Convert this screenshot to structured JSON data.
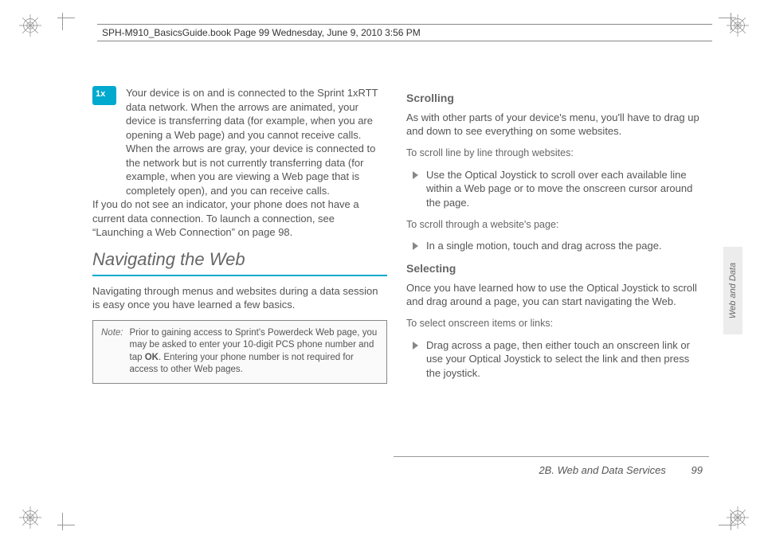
{
  "page_header": "SPH-M910_BasicsGuide.book  Page 99  Wednesday, June 9, 2010  3:56 PM",
  "left": {
    "icon_desc": "Your device is on and is connected to the Sprint 1xRTT data network. When the arrows are animated, your device is transferring data (for example, when you are opening a Web page) and you cannot receive calls. When the arrows are gray, your device is connected to the network but is not currently transferring data (for example, when you are viewing a Web page that is completely open), and you can receive calls.",
    "no_indicator": "If you do not see an indicator, your phone does not have a current data connection. To launch a connection, see “Launching a Web Connection” on page 98.",
    "section_title": "Navigating the Web",
    "section_intro": "Navigating through menus and websites during a data session is easy once you have learned a few basics.",
    "note_label": "Note:",
    "note_text_1": "Prior to gaining access to Sprint's Powerdeck Web page, you may be asked to enter your 10-digit PCS phone number and tap ",
    "note_ok": "OK",
    "note_text_2": ". Entering your phone number is not required for access to other Web pages."
  },
  "right": {
    "scrolling_head": "Scrolling",
    "scrolling_intro": "As with other parts of your device's menu, you'll have to drag up and down to see everything on some websites.",
    "scroll_line_instr": "To scroll line by line through websites:",
    "scroll_line_bullet": "Use the Optical Joystick to scroll over each available line within a Web page or to move the onscreen cursor around the page.",
    "scroll_page_instr": "To scroll through a website's page:",
    "scroll_page_bullet": "In a single motion, touch and drag across the page.",
    "selecting_head": "Selecting",
    "selecting_intro": "Once you have learned how to use the Optical Joystick to scroll and drag around a page, you can start navigating the Web.",
    "select_instr": "To select onscreen items or links:",
    "select_bullet": "Drag across a page, then either touch an onscreen link or use your Optical Joystick to select the link and then press the joystick."
  },
  "side_tab": "Web and Data",
  "footer": {
    "section": "2B. Web and Data Services",
    "page": "99"
  }
}
